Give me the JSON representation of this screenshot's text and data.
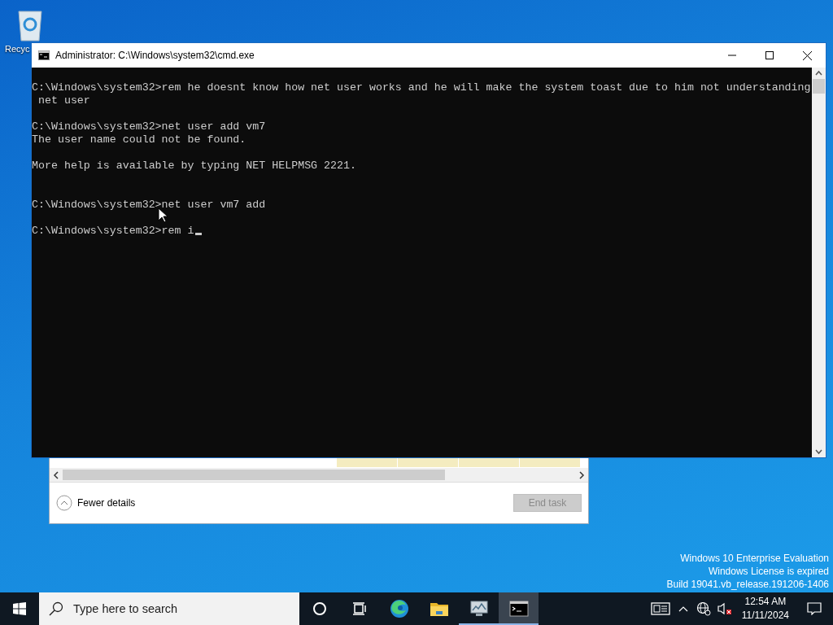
{
  "desktop": {
    "icons": [
      {
        "label": "Recyc"
      }
    ],
    "watermark": [
      "Windows 10 Enterprise Evaluation",
      "Windows License is expired",
      "Build 19041.vb_release.191206-1406"
    ]
  },
  "task_manager": {
    "details_toggle": "Fewer details",
    "end_task": {
      "label": "End task",
      "disabled": true
    }
  },
  "console_window": {
    "title": "Administrator: C:\\Windows\\system32\\cmd.exe",
    "lines": [
      {
        "kind": "text",
        "text": "C:\\Windows\\system32>rem he doesnt know how net user works and he will make the system toast due to him not understanding"
      },
      {
        "kind": "text",
        "text": " net user"
      },
      {
        "kind": "blank"
      },
      {
        "kind": "text",
        "text": "C:\\Windows\\system32>net user add vm7"
      },
      {
        "kind": "text",
        "text": "The user name could not be found."
      },
      {
        "kind": "blank"
      },
      {
        "kind": "text",
        "text": "More help is available by typing NET HELPMSG 2221."
      },
      {
        "kind": "blank"
      },
      {
        "kind": "blank"
      },
      {
        "kind": "text",
        "text": "C:\\Windows\\system32>net user vm7 add"
      },
      {
        "kind": "blank"
      },
      {
        "kind": "prompt",
        "text": "C:\\Windows\\system32>rem i"
      }
    ]
  },
  "taskbar": {
    "search": {
      "placeholder": "Type here to search"
    },
    "apps": [
      {
        "kind": "cortana",
        "running": false,
        "selected": false
      },
      {
        "kind": "task-view",
        "running": false,
        "selected": false
      },
      {
        "kind": "edge",
        "running": false,
        "selected": false
      },
      {
        "kind": "explorer",
        "running": false,
        "selected": false
      },
      {
        "kind": "task-manager",
        "running": true,
        "selected": false
      },
      {
        "kind": "cmd",
        "running": true,
        "selected": true
      }
    ],
    "volume_muted": true,
    "time": "12:54 AM",
    "date": "11/11/2024"
  }
}
